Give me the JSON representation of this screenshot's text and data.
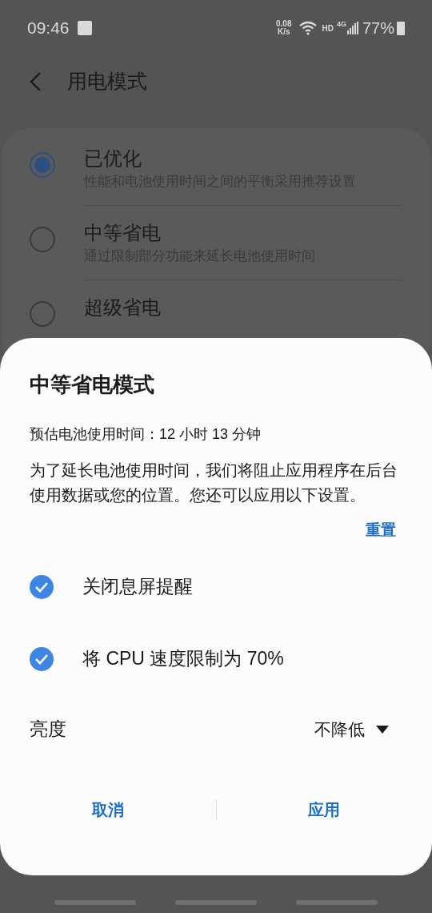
{
  "status_bar": {
    "time": "09:46",
    "speed_value": "0.08",
    "speed_unit": "K/s",
    "hd": "HD",
    "network": "4G",
    "battery": "77%"
  },
  "header": {
    "title": "用电模式"
  },
  "modes": [
    {
      "title": "已优化",
      "subtitle": "性能和电池使用时间之间的平衡采用推荐设置",
      "selected": true
    },
    {
      "title": "中等省电",
      "subtitle": "通过限制部分功能来延长电池使用时间",
      "selected": false
    },
    {
      "title": "超级省电",
      "selected": false
    }
  ],
  "dialog": {
    "title": "中等省电模式",
    "estimate": "预估电池使用时间：12 小时 13 分钟",
    "description": "为了延长电池使用时间，我们将阻止应用程序在后台使用数据或您的位置。您还可以应用以下设置。",
    "reset": "重置",
    "options": [
      {
        "label": "关闭息屏提醒",
        "checked": true
      },
      {
        "label": "将 CPU 速度限制为 70%",
        "checked": true
      }
    ],
    "brightness": {
      "label": "亮度",
      "value": "不降低"
    },
    "buttons": [
      "取消",
      "应用"
    ]
  }
}
